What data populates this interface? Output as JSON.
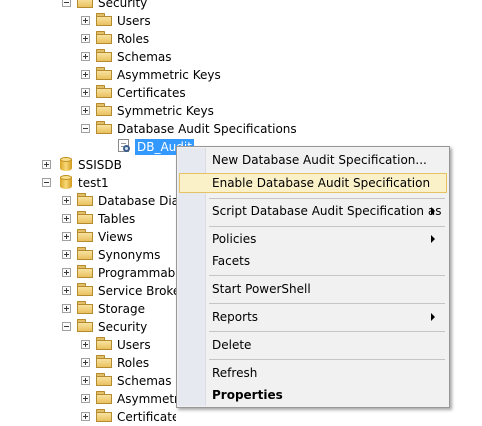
{
  "tree": {
    "nodes": [
      {
        "label": "Security",
        "expander": "minus",
        "icon": "folder"
      },
      {
        "label": "Users",
        "expander": "plus",
        "icon": "folder"
      },
      {
        "label": "Roles",
        "expander": "plus",
        "icon": "folder"
      },
      {
        "label": "Schemas",
        "expander": "plus",
        "icon": "folder"
      },
      {
        "label": "Asymmetric Keys",
        "expander": "plus",
        "icon": "folder"
      },
      {
        "label": "Certificates",
        "expander": "plus",
        "icon": "folder"
      },
      {
        "label": "Symmetric Keys",
        "expander": "plus",
        "icon": "folder"
      },
      {
        "label": "Database Audit Specifications",
        "expander": "minus",
        "icon": "folder"
      },
      {
        "label": "DB_Audit",
        "expander": "none",
        "icon": "audit-spec",
        "selected": true
      },
      {
        "label": "SSISDB",
        "expander": "plus",
        "icon": "database"
      },
      {
        "label": "test1",
        "expander": "minus",
        "icon": "database"
      },
      {
        "label": "Database Diagr",
        "expander": "plus",
        "icon": "folder"
      },
      {
        "label": "Tables",
        "expander": "plus",
        "icon": "folder"
      },
      {
        "label": "Views",
        "expander": "plus",
        "icon": "folder"
      },
      {
        "label": "Synonyms",
        "expander": "plus",
        "icon": "folder"
      },
      {
        "label": "Programmabili",
        "expander": "plus",
        "icon": "folder"
      },
      {
        "label": "Service Broker",
        "expander": "plus",
        "icon": "folder"
      },
      {
        "label": "Storage",
        "expander": "plus",
        "icon": "folder"
      },
      {
        "label": "Security",
        "expander": "minus",
        "icon": "folder"
      },
      {
        "label": "Users",
        "expander": "plus",
        "icon": "folder"
      },
      {
        "label": "Roles",
        "expander": "plus",
        "icon": "folder"
      },
      {
        "label": "Schemas",
        "expander": "plus",
        "icon": "folder"
      },
      {
        "label": "Asymmetri",
        "expander": "plus",
        "icon": "folder"
      },
      {
        "label": "Certificates",
        "expander": "plus",
        "icon": "folder"
      }
    ]
  },
  "context_menu": {
    "items": [
      {
        "label": "New Database Audit Specification..."
      },
      {
        "label": "Enable Database Audit Specification",
        "highlighted": true
      },
      {
        "separator": true
      },
      {
        "label": "Script Database Audit Specification as",
        "submenu": true
      },
      {
        "separator": true
      },
      {
        "label": "Policies",
        "submenu": true
      },
      {
        "label": "Facets"
      },
      {
        "separator": true
      },
      {
        "label": "Start PowerShell"
      },
      {
        "separator": true
      },
      {
        "label": "Reports",
        "submenu": true
      },
      {
        "separator": true
      },
      {
        "label": "Delete"
      },
      {
        "separator": true
      },
      {
        "label": "Refresh"
      },
      {
        "label": "Properties",
        "bold": true
      }
    ]
  },
  "colors": {
    "selection": "#3399ff",
    "menu_highlight": "#fbf1c9",
    "menu_highlight_border": "#e5c365",
    "menu_background": "#f1f1f1"
  }
}
